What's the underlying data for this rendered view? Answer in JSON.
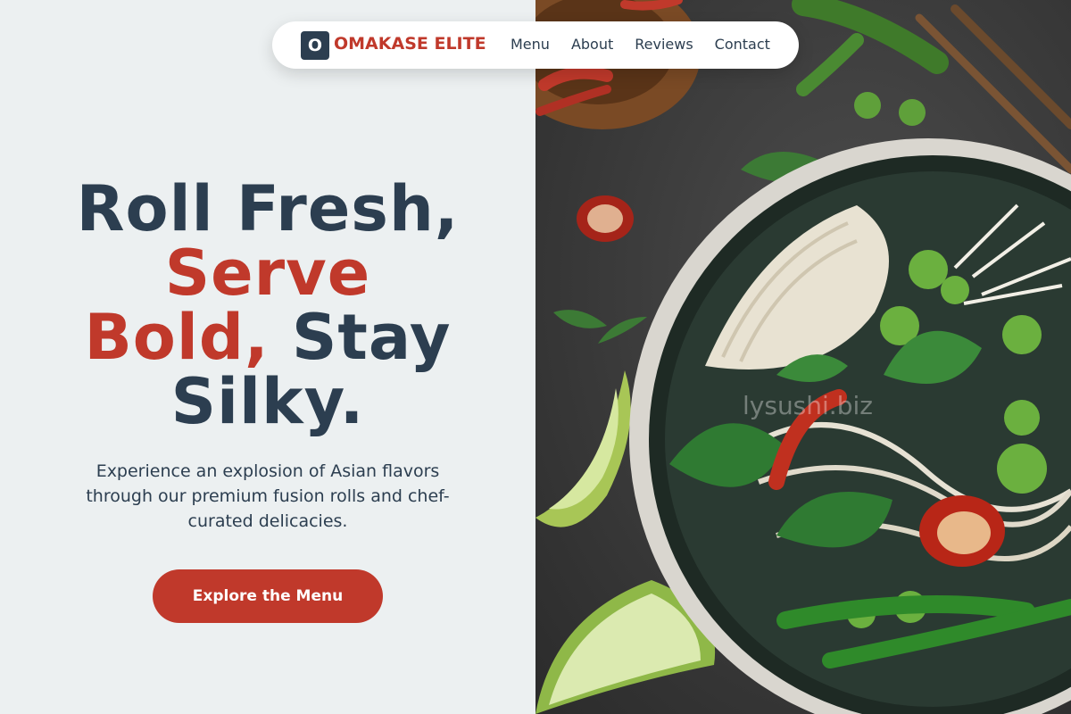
{
  "brand": {
    "badge": "O",
    "name": "OMAKASE ELITE"
  },
  "nav": {
    "links": [
      {
        "label": "Menu"
      },
      {
        "label": "About"
      },
      {
        "label": "Reviews"
      },
      {
        "label": "Contact"
      }
    ]
  },
  "hero": {
    "line1": "Roll Fresh,",
    "line2_red": "Serve",
    "line3_red": "Bold,",
    "line3_dark": " Stay",
    "line4": "Silky.",
    "subtitle": "Experience an explosion of Asian flavors through our premium fusion rolls and chef-curated delicacies.",
    "cta_label": "Explore the Menu"
  },
  "image": {
    "watermark": "lysushi.biz",
    "alt_icon": "noodle-bowl-image"
  },
  "colors": {
    "accent": "#c0392b",
    "dark": "#2c3e50",
    "background": "#ecf0f1"
  }
}
